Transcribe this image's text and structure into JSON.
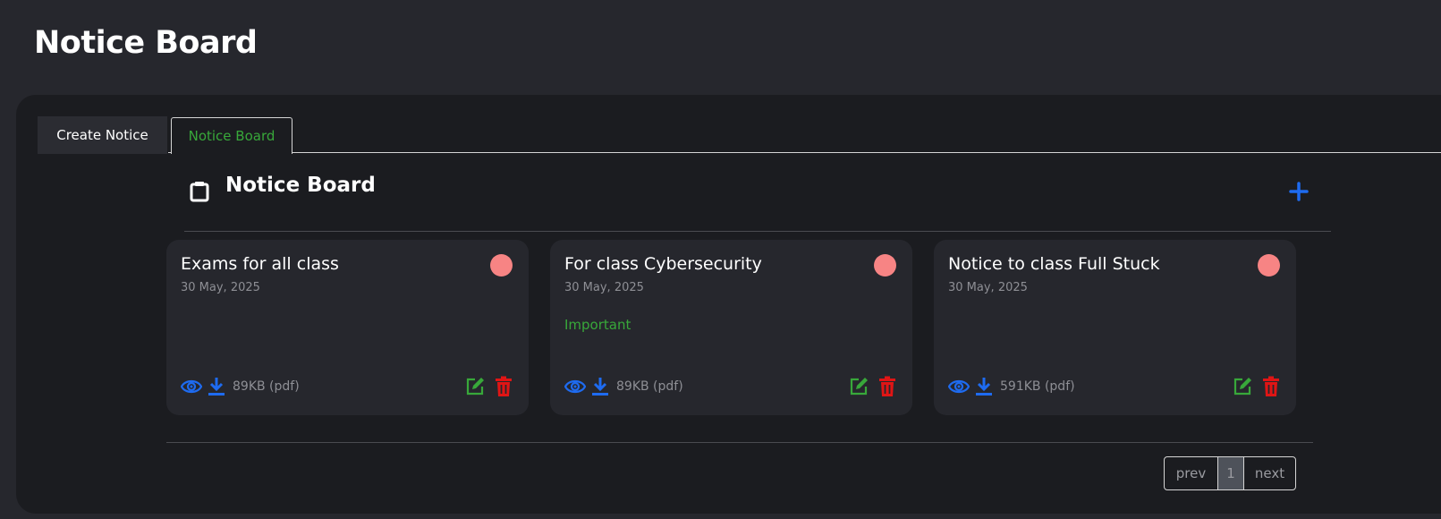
{
  "page": {
    "title": "Notice Board"
  },
  "tabs": [
    {
      "label": "Create Notice",
      "active": false
    },
    {
      "label": "Notice Board",
      "active": true
    }
  ],
  "board": {
    "title": "Notice Board",
    "icon": "clipboard-icon",
    "add_icon": "plus-icon"
  },
  "notices": [
    {
      "title": "Exams for all class",
      "date": "30 May, 2025",
      "tag": "",
      "size": "89KB (pdf)"
    },
    {
      "title": "For class Cybersecurity",
      "date": "30 May, 2025",
      "tag": "Important",
      "size": "89KB (pdf)"
    },
    {
      "title": "Notice to class Full Stuck",
      "date": "30 May, 2025",
      "tag": "",
      "size": "591KB (pdf)"
    }
  ],
  "pagination": {
    "prev": "prev",
    "current": "1",
    "next": "next"
  },
  "colors": {
    "accent_blue": "#1e6bf0",
    "accent_green": "#38a83a",
    "danger_red": "#e01515",
    "status_dot": "#f78484"
  }
}
